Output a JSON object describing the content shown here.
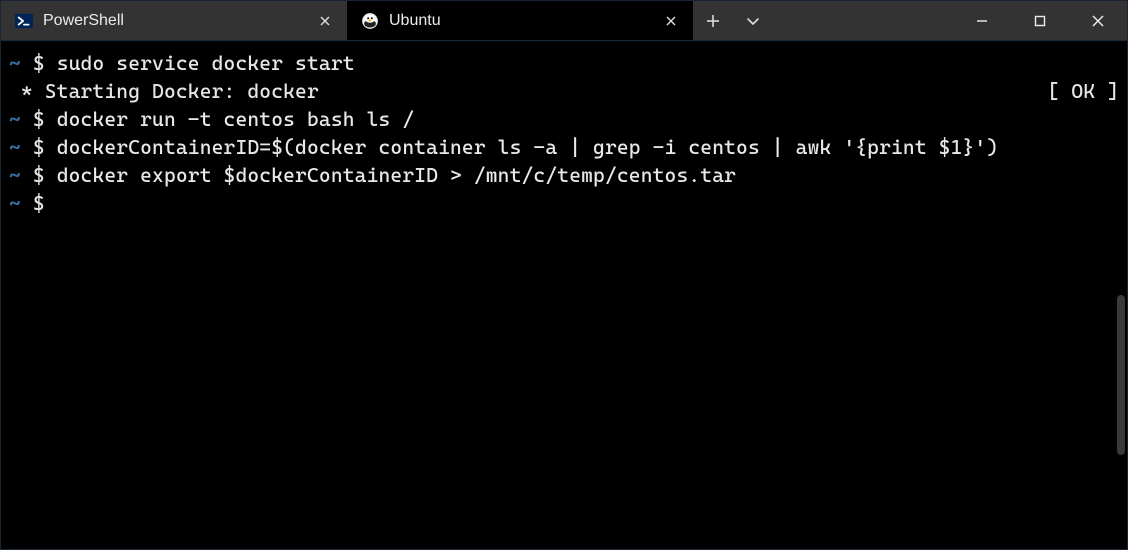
{
  "tabs": [
    {
      "title": "PowerShell",
      "active": false
    },
    {
      "title": "Ubuntu",
      "active": true
    }
  ],
  "buttons": {
    "new_tab": "+",
    "dropdown": "⌄"
  },
  "window_controls": {
    "minimize": "—",
    "maximize": "□",
    "close": "✕"
  },
  "terminal": {
    "prompt_tilde": "~",
    "prompt_dollar": "$",
    "lines": [
      {
        "type": "cmd",
        "text": "sudo service docker start"
      },
      {
        "type": "status",
        "text": " * Starting Docker: docker",
        "status": "[ OK ]"
      },
      {
        "type": "cmd",
        "text": "docker run -t centos bash ls /"
      },
      {
        "type": "cmd",
        "text": "dockerContainerID=$(docker container ls -a | grep -i centos | awk '{print $1}')"
      },
      {
        "type": "cmd",
        "text": "docker export $dockerContainerID > /mnt/c/temp/centos.tar"
      },
      {
        "type": "cmd",
        "text": ""
      }
    ]
  }
}
